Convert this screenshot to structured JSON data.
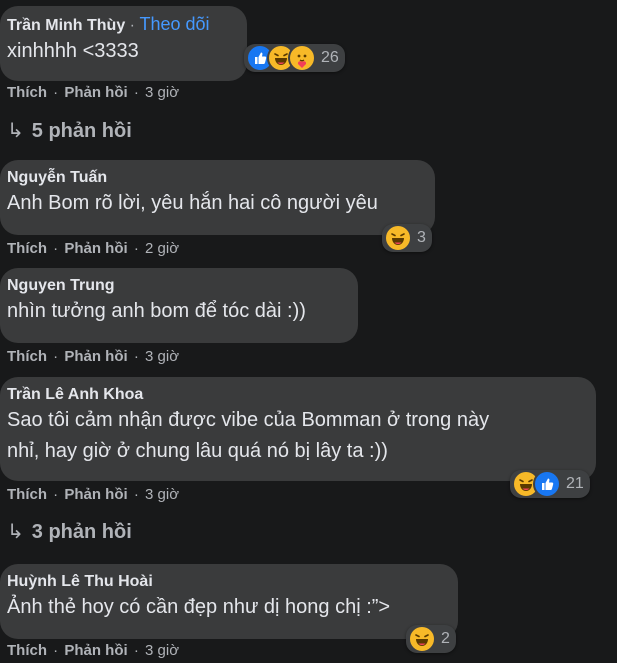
{
  "comments": [
    {
      "author": "Trần Minh Thùy",
      "follow_sep": "·",
      "follow_label": "Theo dõi",
      "text": "xinhhhh <3333",
      "like": "Thích",
      "reply": "Phản hồi",
      "dot": "·",
      "time": "3 giờ",
      "reaction_count": "26",
      "reactions": [
        "like-icon",
        "haha-icon",
        "care-icon"
      ],
      "replies_label": "5 phản hồi"
    },
    {
      "author": "Nguyễn Tuấn",
      "text": "Anh Bom rõ lời, yêu hắn hai cô người yêu",
      "like": "Thích",
      "reply": "Phản hồi",
      "dot": "·",
      "time": "2 giờ",
      "reaction_count": "3",
      "reactions": [
        "haha-icon"
      ]
    },
    {
      "author": "Nguyen Trung",
      "text": "nhìn tưởng anh bom để tóc dài :))",
      "like": "Thích",
      "reply": "Phản hồi",
      "dot": "·",
      "time": "3 giờ"
    },
    {
      "author": "Trần Lê Anh Khoa",
      "text_line1": "Sao tôi cảm nhận được vibe của Bomman ở trong này",
      "text_line2": "nhỉ, hay giờ ở chung lâu quá nó bị lây ta :))",
      "like": "Thích",
      "reply": "Phản hồi",
      "dot": "·",
      "time": "3 giờ",
      "reaction_count": "21",
      "reactions": [
        "haha-icon",
        "like-icon"
      ],
      "replies_label": "3 phản hồi"
    },
    {
      "author": "Huỳnh Lê Thu Hoài",
      "text": "Ảnh thẻ hoy có cần đẹp như dị hong chị :”>",
      "like": "Thích",
      "reply": "Phản hồi",
      "dot": "·",
      "time": "3 giờ",
      "reaction_count": "2",
      "reactions": [
        "haha-icon"
      ]
    }
  ],
  "reply_arrow": "↳",
  "colors": {
    "background": "#18191a",
    "bubble": "#3a3b3c",
    "text": "#e4e6eb",
    "secondary": "#b0b3b8",
    "link": "#4599ff",
    "like_blue": "#1877f2",
    "haha_yellow": "#f7b928"
  }
}
